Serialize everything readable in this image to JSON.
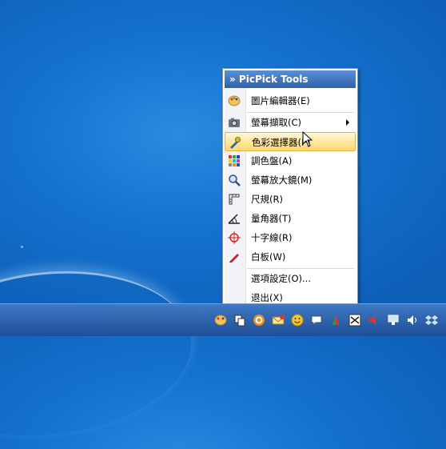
{
  "menu": {
    "title": "» PicPick Tools",
    "items": [
      {
        "label": "圖片編輯器(E)",
        "icon": "palette-icon"
      },
      {
        "label": "螢幕擷取(C)",
        "icon": "camera-icon",
        "submenu": true
      },
      {
        "label": "色彩選擇器(P)",
        "icon": "color-picker-icon",
        "selected": true
      },
      {
        "label": "調色盤(A)",
        "icon": "color-grid-icon"
      },
      {
        "label": "螢幕放大鏡(M)",
        "icon": "magnifier-icon"
      },
      {
        "label": "尺規(R)",
        "icon": "ruler-icon"
      },
      {
        "label": "量角器(T)",
        "icon": "protractor-icon"
      },
      {
        "label": "十字線(R)",
        "icon": "crosshair-icon"
      },
      {
        "label": "白板(W)",
        "icon": "pen-icon"
      },
      {
        "label": "選項設定(O)...",
        "icon": ""
      },
      {
        "label": "退出(X)",
        "icon": ""
      }
    ]
  },
  "taskbar": {
    "tray_icons": [
      "picpick-tray-icon",
      "copy-icon",
      "refresh-icon",
      "mail-icon",
      "smiley-icon",
      "chat-icon",
      "flag-icon",
      "shuffle-icon",
      "speaker-mute-icon",
      "network-icon",
      "volume-icon",
      "dropbox-icon"
    ]
  },
  "colors": {
    "accent": "#2e63ad",
    "highlight": "#ffd76b"
  }
}
